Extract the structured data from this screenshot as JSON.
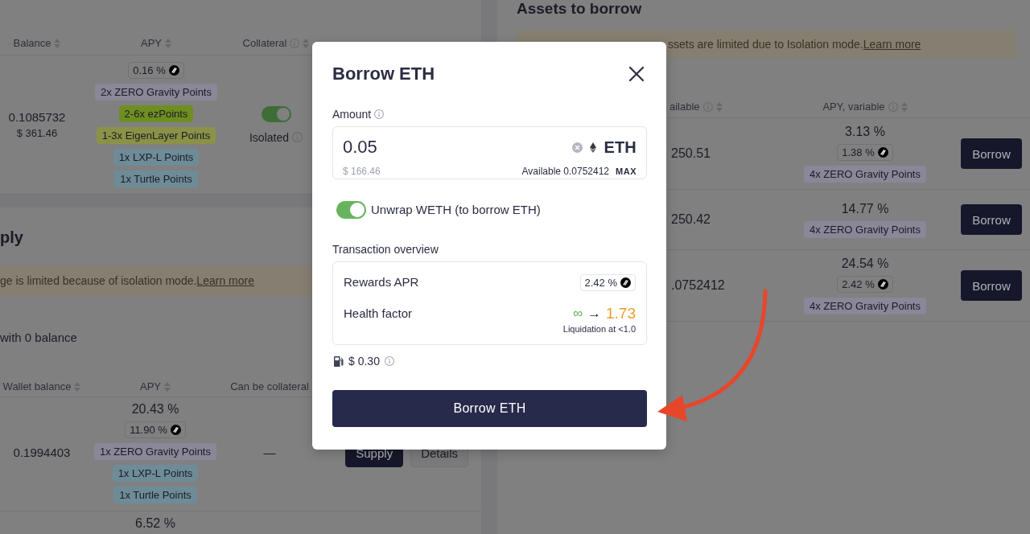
{
  "supplies": {
    "columns": [
      {
        "label": "Balance",
        "info": false,
        "sortable": true
      },
      {
        "label": "APY",
        "info": false,
        "sortable": true
      },
      {
        "label": "Collateral",
        "info": true,
        "sortable": true
      }
    ],
    "rows": [
      {
        "balance": "0.1085732",
        "balance_usd": "$ 361.46",
        "rewards_apr": "0.16 %",
        "points": [
          {
            "label": "2x ZERO Gravity Points",
            "color": "#8a8798"
          },
          {
            "label": "2-6x ezPoints",
            "color": "#6e8e22"
          },
          {
            "label": "1-3x EigenLayer Points",
            "color": "#8b9248"
          },
          {
            "label": "1x LXP-L Points",
            "color": "#6e8c98"
          },
          {
            "label": "1x Turtle Points",
            "color": "#6e8c98"
          }
        ],
        "collateral": {
          "on": true,
          "label": "Isolated",
          "info": true
        }
      }
    ]
  },
  "assets_to_supply": {
    "title": "ply",
    "notice": {
      "text": "ge is limited because of isolation mode.",
      "link": "Learn more"
    },
    "zero_balance_label": "with 0 balance",
    "columns": [
      {
        "label": "Wallet balance",
        "info": false,
        "sortable": true
      },
      {
        "label": "APY",
        "info": false,
        "sortable": true
      },
      {
        "label": "Can be collateral",
        "info": false,
        "sortable": false
      }
    ],
    "rows": [
      {
        "wallet_balance": "0.1994403",
        "apy": "20.43 %",
        "rewards_apr": "11.90 %",
        "points": [
          {
            "label": "1x ZERO Gravity Points",
            "color": "#8a8798"
          },
          {
            "label": "1x LXP-L Points",
            "color": "#6e8c98"
          },
          {
            "label": "1x Turtle Points",
            "color": "#6e8c98"
          }
        ],
        "collateral": "—",
        "actions": [
          {
            "label": "Supply",
            "kind": "primary"
          },
          {
            "label": "Details",
            "kind": "secondary"
          }
        ]
      },
      {
        "apy": "6.52 %"
      }
    ]
  },
  "assets_to_borrow": {
    "title": "Assets to borrow",
    "notice": {
      "text": "ssets are limited due to Isolation mode.",
      "link": "Learn more"
    },
    "columns": [
      {
        "label": "ailable",
        "info": true,
        "sortable": true
      },
      {
        "label": "APY, variable",
        "info": true,
        "sortable": true
      }
    ],
    "rows": [
      {
        "available": "250.51",
        "apy": "3.13 %",
        "rewards_apr": "1.38 %",
        "points": [
          {
            "label": "4x ZERO Gravity Points",
            "color": "#8a8798"
          }
        ],
        "action": "Borrow"
      },
      {
        "available": "250.42",
        "apy": "14.77 %",
        "points": [
          {
            "label": "4x ZERO Gravity Points",
            "color": "#8a8798"
          }
        ],
        "action": "Borrow"
      },
      {
        "available": ".0752412",
        "apy": "24.54 %",
        "rewards_apr": "2.42 %",
        "points": [
          {
            "label": "4x ZERO Gravity Points",
            "color": "#8a8798"
          }
        ],
        "action": "Borrow"
      }
    ]
  },
  "modal": {
    "title": "Borrow ETH",
    "amount": {
      "label": "Amount",
      "info": true,
      "value": "0.05",
      "usd": "$ 166.46",
      "token": "ETH",
      "available": "Available 0.0752412",
      "max": "MAX"
    },
    "unwrap": {
      "label": "Unwrap WETH (to borrow ETH)",
      "on": true
    },
    "overview": {
      "title": "Transaction overview",
      "rows": [
        {
          "kind": "rewards",
          "label": "Rewards APR",
          "value": "2.42 %"
        },
        {
          "kind": "health",
          "label": "Health factor",
          "from": "∞",
          "arrow": "→",
          "to": "1.73",
          "note": "Liquidation at <1.0"
        }
      ]
    },
    "gas": {
      "value": "$ 0.30",
      "info": true
    },
    "submit": "Borrow ETH"
  }
}
